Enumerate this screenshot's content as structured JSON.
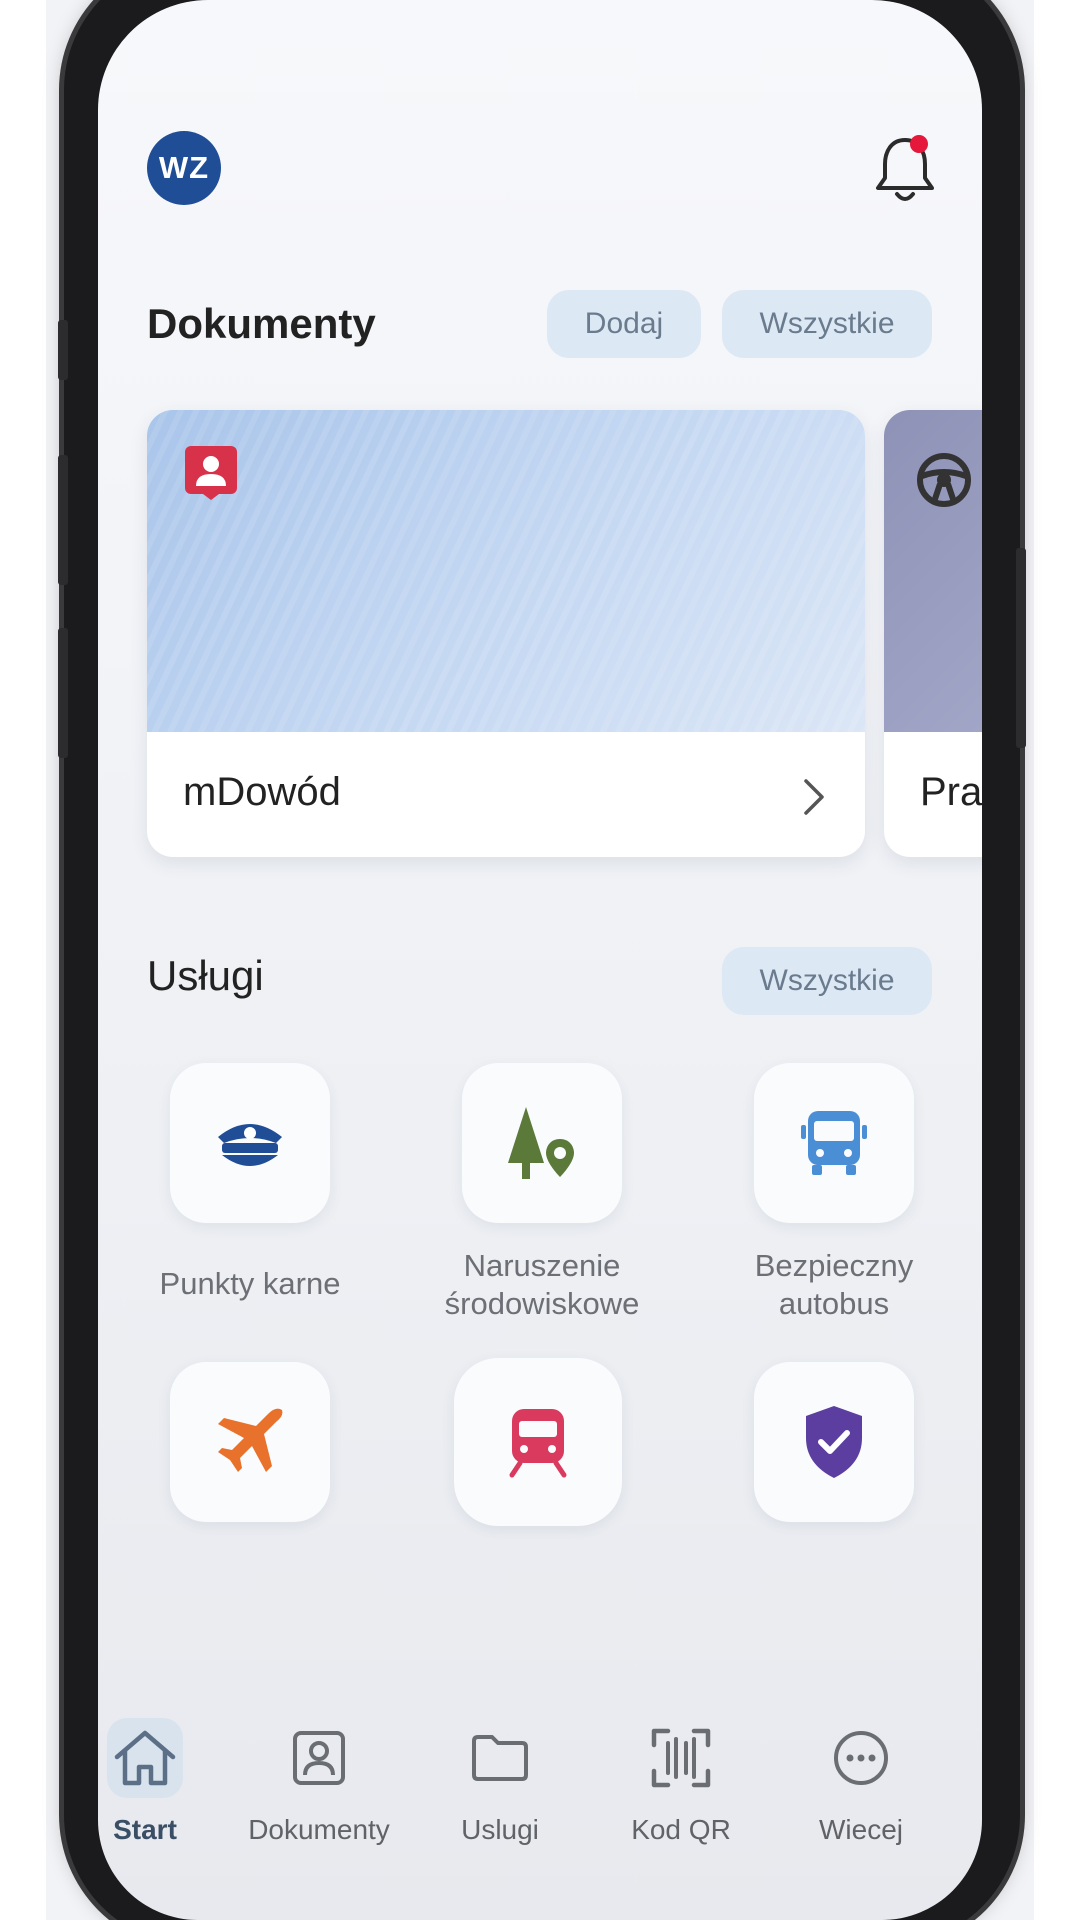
{
  "header": {
    "avatar_initials": "WZ",
    "notification_badge": true,
    "colors": {
      "avatar_bg": "#1f4e96",
      "badge": "#e5173a"
    }
  },
  "documents": {
    "title": "Dokumenty",
    "add_label": "Dodaj",
    "all_label": "Wszystkie",
    "cards": [
      {
        "name": "mDowód",
        "icon": "id-card-icon",
        "color": "#d8324b"
      },
      {
        "name": "Pra",
        "icon": "steering-wheel-icon",
        "color": "#333333"
      }
    ]
  },
  "services": {
    "title": "Usługi",
    "all_label": "Wszystkie",
    "items": [
      {
        "label_line1": "Punkty karne",
        "label_line2": "",
        "icon": "police-cap-icon",
        "color": "#1f4e96"
      },
      {
        "label_line1": "Naruszenie",
        "label_line2": "środowiskowe",
        "icon": "tree-location-icon",
        "color": "#5b7a3a"
      },
      {
        "label_line1": "Bezpieczny",
        "label_line2": "autobus",
        "icon": "bus-icon",
        "color": "#4a8fd6"
      },
      {
        "label_line1": "",
        "label_line2": "",
        "icon": "airplane-icon",
        "color": "#e8722c"
      },
      {
        "label_line1": "",
        "label_line2": "",
        "icon": "train-icon",
        "color": "#d93a5e"
      },
      {
        "label_line1": "",
        "label_line2": "",
        "icon": "shield-check-icon",
        "color": "#5b3ea0"
      }
    ]
  },
  "bottom_nav": {
    "items": [
      {
        "label": "Start",
        "icon": "home-icon",
        "active": true
      },
      {
        "label": "Dokumenty",
        "icon": "document-person-icon",
        "active": false
      },
      {
        "label": "Uslugi",
        "icon": "folder-icon",
        "active": false
      },
      {
        "label": "Kod QR",
        "icon": "qr-scan-icon",
        "active": false
      },
      {
        "label": "Wiecej",
        "icon": "more-icon",
        "active": false
      }
    ]
  }
}
